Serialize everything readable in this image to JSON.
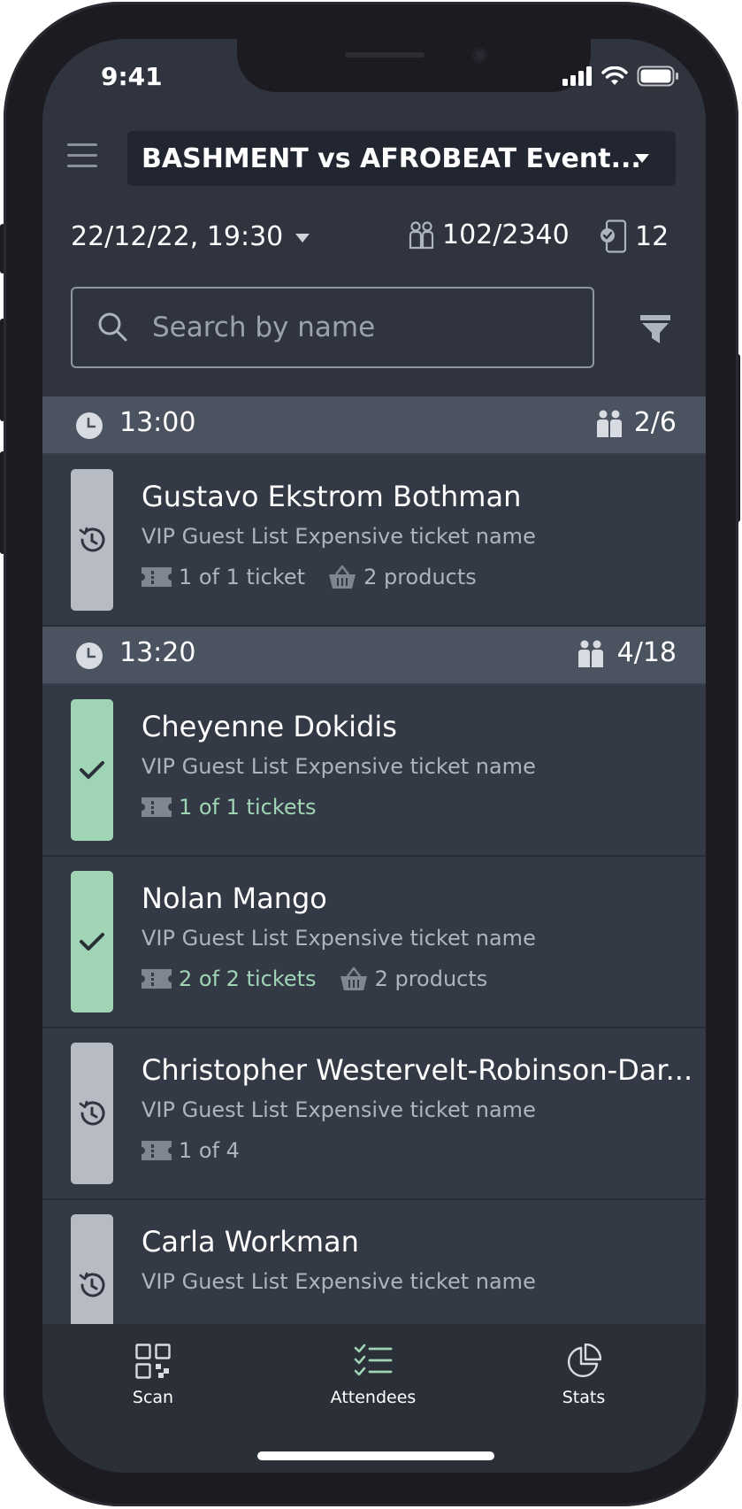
{
  "status_bar": {
    "time": "9:41"
  },
  "header": {
    "event_title": "BASHMENT vs AFROBEAT Event..."
  },
  "info": {
    "date": "22/12/22, 19:30",
    "capacity": "102/2340",
    "devices": "12"
  },
  "search": {
    "placeholder": "Search by name"
  },
  "groups": [
    {
      "time": "13:00",
      "count": "2/6",
      "attendees": [
        {
          "name": "Gustavo Ekstrom Bothman",
          "ticket": "VIP Guest List Expensive ticket name",
          "tickets_text": "1 of 1 ticket",
          "products_text": "2 products",
          "status": "pending"
        }
      ]
    },
    {
      "time": "13:20",
      "count": "4/18",
      "attendees": [
        {
          "name": "Cheyenne Dokidis",
          "ticket": "VIP Guest List Expensive ticket name",
          "tickets_text": "1 of 1 tickets",
          "products_text": "",
          "status": "checked"
        },
        {
          "name": "Nolan Mango",
          "ticket": "VIP Guest List Expensive ticket name",
          "tickets_text": "2 of 2 tickets",
          "products_text": "2 products",
          "status": "checked"
        },
        {
          "name": "Christopher Westervelt-Robinson-Dar...",
          "ticket": "VIP Guest List Expensive ticket name",
          "tickets_text": "1 of 4",
          "products_text": "",
          "status": "pending"
        },
        {
          "name": "Carla Workman",
          "ticket": "VIP Guest List Expensive ticket name",
          "tickets_text": "",
          "products_text": "",
          "status": "pending"
        }
      ]
    }
  ],
  "tabs": [
    {
      "label": "Scan",
      "icon": "qr-scan-icon",
      "active": false
    },
    {
      "label": "Attendees",
      "icon": "checklist-icon",
      "active": true
    },
    {
      "label": "Stats",
      "icon": "pie-chart-icon",
      "active": false
    }
  ],
  "colors": {
    "checked": "#9fd4b5",
    "pending": "#b6bbc4",
    "accent": "#9fd4b5",
    "background": "#2f343e"
  }
}
